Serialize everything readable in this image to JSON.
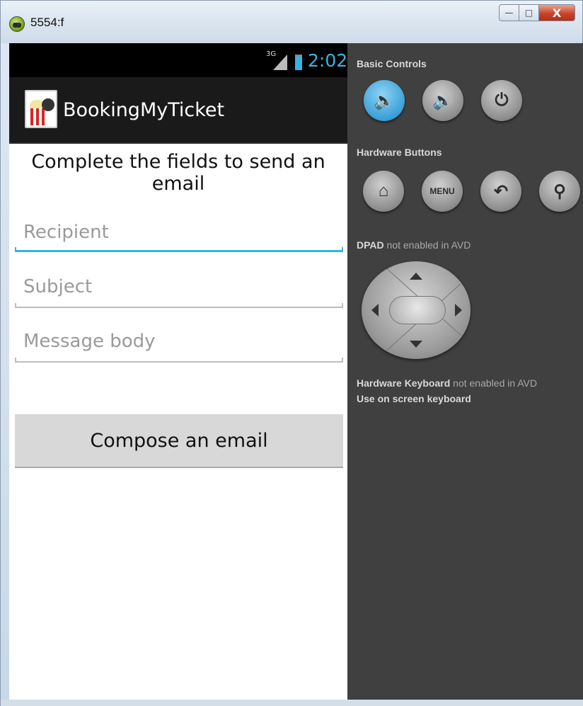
{
  "window": {
    "title": "5554:f",
    "controls": {
      "minimize": "—",
      "maximize": "□",
      "close": "X"
    }
  },
  "statusbar": {
    "network": "3G",
    "time": "2:02"
  },
  "app": {
    "title": "BookingMyTicket"
  },
  "form": {
    "heading": "Complete the fields to send an email",
    "recipient": {
      "placeholder": "Recipient",
      "value": ""
    },
    "subject": {
      "placeholder": "Subject",
      "value": ""
    },
    "body": {
      "placeholder": "Message body",
      "value": ""
    },
    "compose_label": "Compose an email"
  },
  "panel": {
    "basic_controls": "Basic Controls",
    "hardware_buttons": "Hardware Buttons",
    "menu_label": "MENU",
    "dpad_label": "DPAD",
    "dpad_status": " not enabled in AVD",
    "keyboard_label": "Hardware Keyboard",
    "keyboard_status": " not enabled in AVD",
    "keyboard_hint": "Use on screen keyboard"
  },
  "colors": {
    "accent": "#33b5e5",
    "actionbar": "#1a1a1a",
    "panel": "#404040"
  },
  "icons": [
    "volume-down-icon",
    "volume-up-icon",
    "power-icon",
    "home-icon",
    "menu-icon",
    "back-icon",
    "search-icon"
  ]
}
